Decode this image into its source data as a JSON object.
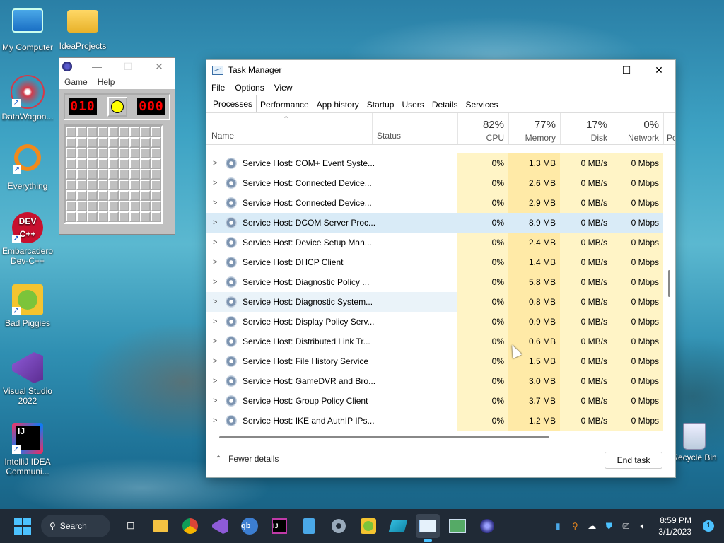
{
  "desktop": {
    "icons": [
      {
        "label": "My Computer"
      },
      {
        "label": "IdeaProjects"
      },
      {
        "label": "DataWagon..."
      },
      {
        "label": "Everything"
      },
      {
        "label": "Embarcadero Dev-C++"
      },
      {
        "label": "Bad Piggies"
      },
      {
        "label": "Visual Studio 2022"
      },
      {
        "label": "IntelliJ IDEA Communi..."
      },
      {
        "label": "Recycle Bin"
      }
    ]
  },
  "minesweeper": {
    "menu": [
      "Game",
      "Help"
    ],
    "mine_counter": "010",
    "timer": "000",
    "controls": {
      "minimize": "—",
      "maximize": "☐",
      "close": "✕"
    }
  },
  "taskmanager": {
    "title": "Task Manager",
    "controls": {
      "minimize": "—",
      "maximize": "☐",
      "close": "✕"
    },
    "menu": [
      "File",
      "Options",
      "View"
    ],
    "tabs": [
      "Processes",
      "Performance",
      "App history",
      "Startup",
      "Users",
      "Details",
      "Services"
    ],
    "active_tab": "Processes",
    "columns": {
      "name": "Name",
      "status": "Status",
      "cpu": {
        "pct": "82%",
        "label": "CPU"
      },
      "memory": {
        "pct": "77%",
        "label": "Memory"
      },
      "disk": {
        "pct": "17%",
        "label": "Disk"
      },
      "network": {
        "pct": "0%",
        "label": "Network"
      },
      "power": "Po"
    },
    "rows": [
      {
        "name": "Service Host: COM+ Event Syste...",
        "cpu": "0%",
        "memory": "1.3 MB",
        "disk": "0 MB/s",
        "network": "0 Mbps"
      },
      {
        "name": "Service Host: Connected Device...",
        "cpu": "0%",
        "memory": "2.6 MB",
        "disk": "0 MB/s",
        "network": "0 Mbps"
      },
      {
        "name": "Service Host: Connected Device...",
        "cpu": "0%",
        "memory": "2.9 MB",
        "disk": "0 MB/s",
        "network": "0 Mbps"
      },
      {
        "name": "Service Host: DCOM Server Proc...",
        "cpu": "0%",
        "memory": "8.9 MB",
        "disk": "0 MB/s",
        "network": "0 Mbps"
      },
      {
        "name": "Service Host: Device Setup Man...",
        "cpu": "0%",
        "memory": "2.4 MB",
        "disk": "0 MB/s",
        "network": "0 Mbps"
      },
      {
        "name": "Service Host: DHCP Client",
        "cpu": "0%",
        "memory": "1.4 MB",
        "disk": "0 MB/s",
        "network": "0 Mbps"
      },
      {
        "name": "Service Host: Diagnostic Policy ...",
        "cpu": "0%",
        "memory": "5.8 MB",
        "disk": "0 MB/s",
        "network": "0 Mbps"
      },
      {
        "name": "Service Host: Diagnostic System...",
        "cpu": "0%",
        "memory": "0.8 MB",
        "disk": "0 MB/s",
        "network": "0 Mbps"
      },
      {
        "name": "Service Host: Display Policy Serv...",
        "cpu": "0%",
        "memory": "0.9 MB",
        "disk": "0 MB/s",
        "network": "0 Mbps"
      },
      {
        "name": "Service Host: Distributed Link Tr...",
        "cpu": "0%",
        "memory": "0.6 MB",
        "disk": "0 MB/s",
        "network": "0 Mbps"
      },
      {
        "name": "Service Host: File History Service",
        "cpu": "0%",
        "memory": "1.5 MB",
        "disk": "0 MB/s",
        "network": "0 Mbps"
      },
      {
        "name": "Service Host: GameDVR and Bro...",
        "cpu": "0%",
        "memory": "3.0 MB",
        "disk": "0 MB/s",
        "network": "0 Mbps"
      },
      {
        "name": "Service Host: Group Policy Client",
        "cpu": "0%",
        "memory": "3.7 MB",
        "disk": "0 MB/s",
        "network": "0 Mbps"
      },
      {
        "name": "Service Host: IKE and AuthIP IPs...",
        "cpu": "0%",
        "memory": "1.2 MB",
        "disk": "0 MB/s",
        "network": "0 Mbps"
      }
    ],
    "footer": {
      "fewer_details": "Fewer details",
      "end_task": "End task"
    }
  },
  "taskbar": {
    "search_label": "Search",
    "clock_time": "8:59 PM",
    "clock_date": "3/1/2023",
    "notification_count": "1"
  }
}
